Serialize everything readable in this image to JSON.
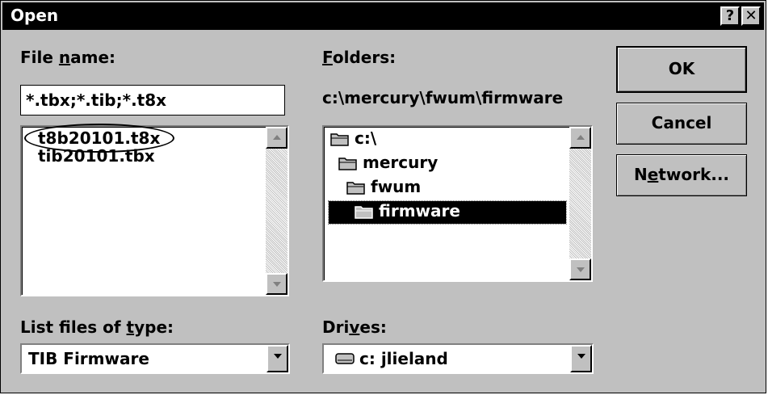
{
  "window": {
    "title": "Open",
    "help_label": "?",
    "close_label": "✕"
  },
  "file_name": {
    "label_pre": "File ",
    "label_u": "n",
    "label_post": "ame:",
    "value": "*.tbx;*.tib;*.t8x",
    "files": [
      "t8b20101.t8x",
      "tib20101.tbx"
    ]
  },
  "folders": {
    "label_u": "F",
    "label_post": "olders:",
    "path": "c:\\mercury\\fwum\\firmware",
    "items": [
      "c:\\",
      "mercury",
      "fwum",
      "firmware"
    ],
    "selected": "firmware"
  },
  "file_type": {
    "label_pre": "List files of ",
    "label_u": "t",
    "label_post": "ype:",
    "value": "TIB Firmware"
  },
  "drives": {
    "label_pre": "Dri",
    "label_u": "v",
    "label_post": "es:",
    "value": "c: jlieland"
  },
  "buttons": {
    "ok": "OK",
    "cancel": "Cancel",
    "network_pre": "N",
    "network_u": "e",
    "network_post": "twork..."
  },
  "icons": [
    "folder-open-icon",
    "drive-icon",
    "scroll-up-icon",
    "scroll-down-icon",
    "dropdown-arrow-icon"
  ]
}
